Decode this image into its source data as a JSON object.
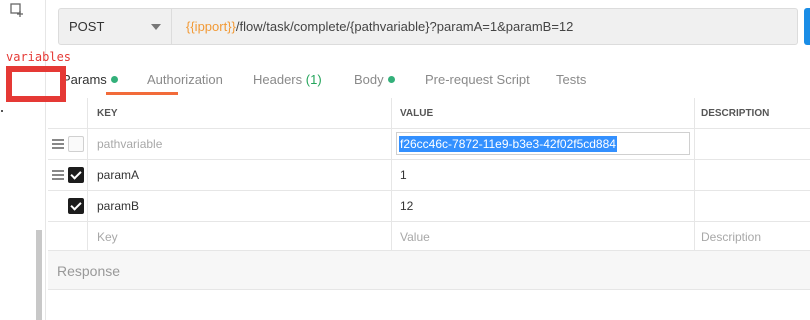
{
  "annotation": {
    "text": "variables",
    "color": "#e53935"
  },
  "request": {
    "method": "POST",
    "url_var": "{{ipport}}",
    "url_rest": "/flow/task/complete/{pathvariable}?paramA=1&paramB=12"
  },
  "tabs": [
    {
      "label": "Params",
      "dot": true,
      "active": true
    },
    {
      "label": "Authorization"
    },
    {
      "label": "Headers",
      "count": "(1)"
    },
    {
      "label": "Body",
      "dot": true
    },
    {
      "label": "Pre-request Script"
    },
    {
      "label": "Tests"
    }
  ],
  "table": {
    "headers": {
      "key": "KEY",
      "value": "VALUE",
      "description": "DESCRIPTION"
    },
    "rows": [
      {
        "key": "pathvariable",
        "value": "f26cc46c-7872-11e9-b3e3-42f02f5cd884",
        "checked": false
      },
      {
        "key": "paramA",
        "value": "1",
        "checked": true
      },
      {
        "key": "paramB",
        "value": "12",
        "checked": true
      }
    ],
    "placeholders": {
      "key": "Key",
      "value": "Value",
      "description": "Description"
    }
  },
  "response": {
    "label": "Response"
  },
  "colors": {
    "accent": "#f26b3a",
    "var": "#f29a36",
    "selection": "#3390ff",
    "dot": "#33b07a"
  }
}
